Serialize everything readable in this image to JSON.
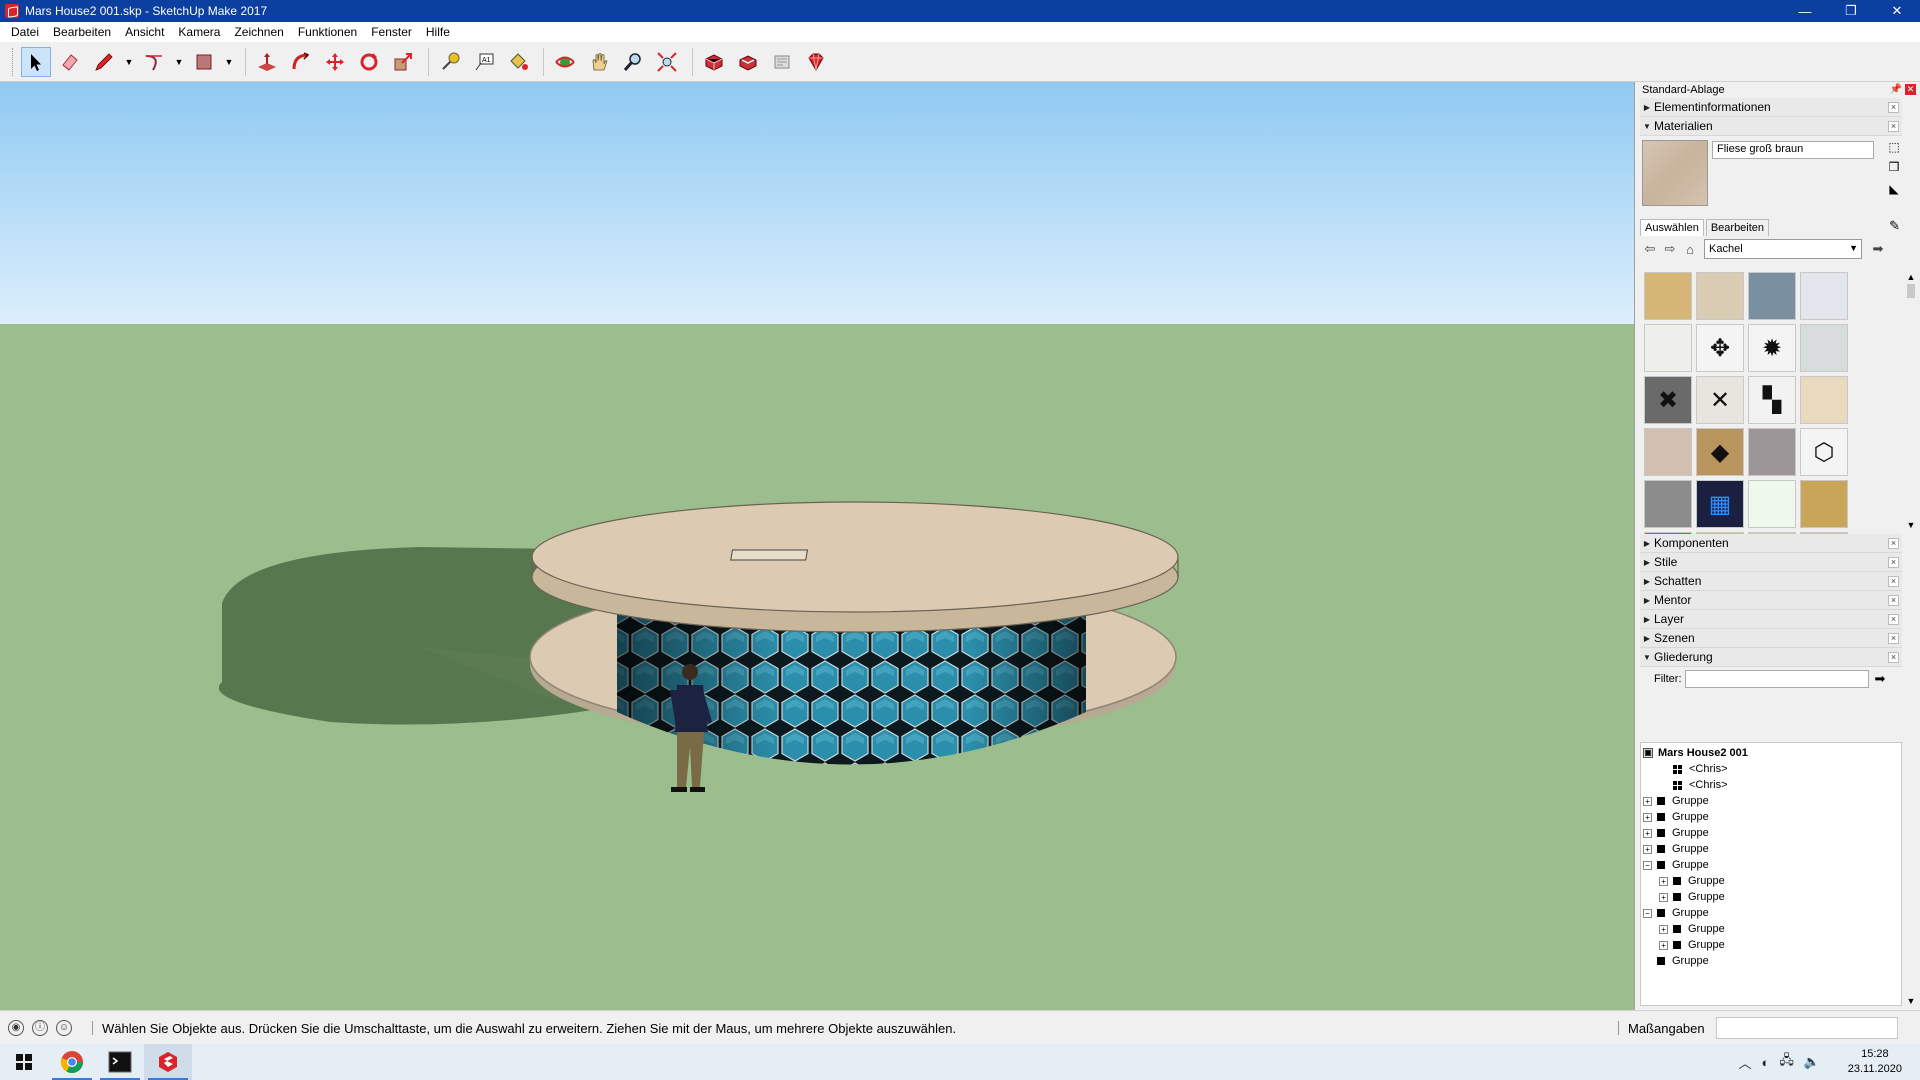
{
  "window": {
    "title": "Mars House2 001.skp - SketchUp Make 2017",
    "minimize": "—",
    "maximize": "❐",
    "close": "✕"
  },
  "menu": [
    "Datei",
    "Bearbeiten",
    "Ansicht",
    "Kamera",
    "Zeichnen",
    "Funktionen",
    "Fenster",
    "Hilfe"
  ],
  "tray": {
    "title": "Standard-Ablage",
    "panels": {
      "elementinfo": "Elementinformationen",
      "materialien": "Materialien",
      "komponenten": "Komponenten",
      "stile": "Stile",
      "schatten": "Schatten",
      "mentor": "Mentor",
      "layer": "Layer",
      "szenen": "Szenen",
      "gliederung": "Gliederung"
    },
    "material_name": "Fliese groß braun",
    "tab_select": "Auswählen",
    "tab_edit": "Bearbeiten",
    "library": "Kachel",
    "filter_label": "Filter:",
    "outline": {
      "root": "Mars House2 001",
      "rows": [
        {
          "label": "<Chris>",
          "indent": 1,
          "type": "comp",
          "exp": ""
        },
        {
          "label": "<Chris>",
          "indent": 1,
          "type": "comp",
          "exp": ""
        },
        {
          "label": "Gruppe",
          "indent": 0,
          "type": "group",
          "exp": "+"
        },
        {
          "label": "Gruppe",
          "indent": 0,
          "type": "group",
          "exp": "+"
        },
        {
          "label": "Gruppe",
          "indent": 0,
          "type": "group",
          "exp": "+"
        },
        {
          "label": "Gruppe",
          "indent": 0,
          "type": "group",
          "exp": "+"
        },
        {
          "label": "Gruppe",
          "indent": 0,
          "type": "group",
          "exp": "−"
        },
        {
          "label": "Gruppe",
          "indent": 1,
          "type": "group",
          "exp": "+"
        },
        {
          "label": "Gruppe",
          "indent": 1,
          "type": "group",
          "exp": "+"
        },
        {
          "label": "Gruppe",
          "indent": 0,
          "type": "group",
          "exp": "−"
        },
        {
          "label": "Gruppe",
          "indent": 1,
          "type": "group",
          "exp": "+"
        },
        {
          "label": "Gruppe",
          "indent": 1,
          "type": "group",
          "exp": "+"
        },
        {
          "label": "Gruppe",
          "indent": 0,
          "type": "group",
          "exp": ""
        }
      ]
    }
  },
  "swatches": [
    {
      "color": "#d6b676",
      "glyph": ""
    },
    {
      "color": "#d9ccb2",
      "glyph": ""
    },
    {
      "color": "#7a8fa0",
      "glyph": ""
    },
    {
      "color": "#e4e6ee",
      "glyph": ""
    },
    {
      "color": "#eeeeea",
      "glyph": ""
    },
    {
      "color": "#f4f4f4",
      "glyph": "✥"
    },
    {
      "color": "#f4f4f4",
      "glyph": "✹"
    },
    {
      "color": "#d9dcdc",
      "glyph": ""
    },
    {
      "color": "#6a6a6a",
      "glyph": "✖"
    },
    {
      "color": "#e8e4de",
      "glyph": "✕"
    },
    {
      "color": "#f2f2f2",
      "glyph": "▚"
    },
    {
      "color": "#e9d9bf",
      "glyph": ""
    },
    {
      "color": "#d2bfb1",
      "glyph": ""
    },
    {
      "color": "#b9945d",
      "glyph": "◆"
    },
    {
      "color": "#9c9698",
      "glyph": ""
    },
    {
      "color": "#f4f4f4",
      "glyph": "⬡"
    },
    {
      "color": "#8c8c8c",
      "glyph": ""
    },
    {
      "color": "#1b2040",
      "glyph": "▦"
    },
    {
      "color": "#eef8ec",
      "glyph": ""
    },
    {
      "color": "#c9a55a",
      "glyph": ""
    },
    {
      "color": "#b3613c",
      "glyph": ""
    },
    {
      "color": "#c8c393",
      "glyph": ""
    },
    {
      "color": "#c9c8a9",
      "glyph": ""
    },
    {
      "color": "#cdc3b3",
      "glyph": ""
    }
  ],
  "status": {
    "message": "Wählen Sie Objekte aus. Drücken Sie die Umschalttaste, um die Auswahl zu erweitern. Ziehen Sie mit der Maus, um mehrere Objekte auszuwählen.",
    "measurements_label": "Maßangaben"
  },
  "clock": {
    "time": "15:28",
    "date": "23.11.2020"
  },
  "icons": {
    "select": "select-arrow-icon",
    "eraser": "eraser-icon",
    "line": "pencil-icon",
    "arc": "arc-icon",
    "shape": "rectangle-icon",
    "pushpull": "push-pull-icon",
    "followme": "follow-me-icon",
    "move": "move-icon",
    "rotate": "rotate-icon",
    "scale": "scale-icon",
    "tape": "tape-measure-icon",
    "text": "text-icon",
    "paint": "paint-bucket-icon",
    "orbit": "orbit-icon",
    "pan": "pan-icon",
    "zoom": "zoom-icon",
    "zoomext": "zoom-extents-icon",
    "warehouse": "3d-warehouse-icon",
    "extwarehouse": "extension-warehouse-icon",
    "layout": "send-to-layout-icon",
    "ruby": "extension-manager-icon"
  },
  "colors": {
    "titlebar": "#0b3fa0",
    "sky_top": "#8fc9f2",
    "ground": "#9cbd8e",
    "hex_glass": "#2b8fab",
    "disc": "#dccbb2"
  }
}
